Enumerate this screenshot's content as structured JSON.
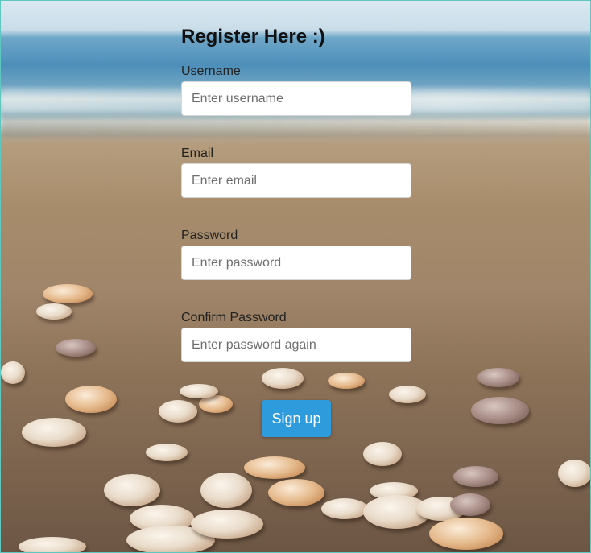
{
  "form": {
    "title": "Register Here :)",
    "fields": [
      {
        "label": "Username",
        "placeholder": "Enter username",
        "value": ""
      },
      {
        "label": "Email",
        "placeholder": "Enter email",
        "value": ""
      },
      {
        "label": "Password",
        "placeholder": "Enter password",
        "value": ""
      },
      {
        "label": "Confirm Password",
        "placeholder": "Enter password again",
        "value": ""
      }
    ],
    "submit_label": "Sign up"
  },
  "colors": {
    "button": "#2e9bdc",
    "frame_border": "#5ec8c0"
  }
}
